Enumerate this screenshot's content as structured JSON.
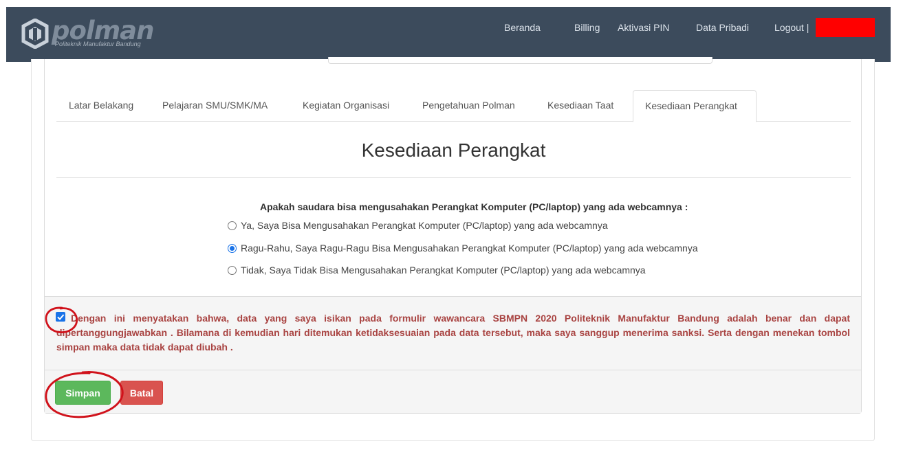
{
  "header": {
    "logo_text": "polman",
    "logo_subtitle": "Politeknik Manufaktur Bandung",
    "nav": {
      "beranda": "Beranda",
      "billing": "Billing",
      "aktivasi_pin": "Aktivasi PIN",
      "data_pribadi": "Data Pribadi",
      "logout": "Logout |"
    }
  },
  "tabs": {
    "latar_belakang": "Latar Belakang",
    "pelajaran": "Pelajaran SMU/SMK/MA",
    "kegiatan": "Kegiatan Organisasi",
    "pengetahuan": "Pengetahuan Polman",
    "kesediaan_taat": "Kesediaan Taat",
    "kesediaan_perangkat": "Kesediaan Perangkat",
    "active": "Kesediaan Perangkat"
  },
  "section": {
    "title": "Kesediaan Perangkat",
    "question": "Apakah saudara bisa mengusahakan Perangkat Komputer (PC/laptop) yang ada webcamnya :",
    "options": [
      {
        "label": "Ya, Saya Bisa Mengusahakan Perangkat Komputer (PC/laptop) yang ada webcamnya",
        "selected": false
      },
      {
        "label": "Ragu-Rahu, Saya Ragu-Ragu Bisa Mengusahakan Perangkat Komputer (PC/laptop) yang ada webcamnya",
        "selected": true
      },
      {
        "label": "Tidak, Saya Tidak Bisa Mengusahakan Perangkat Komputer (PC/laptop) yang ada webcamnya",
        "selected": false
      }
    ]
  },
  "agreement": {
    "checked": true,
    "text": "Dengan ini menyatakan bahwa, data yang saya isikan pada formulir wawancara SBMPN 2020 Politeknik Manufaktur Bandung adalah benar dan dapat dipertanggungjawabkan . Bilamana di kemudian hari ditemukan ketidaksesuaian pada data tersebut, maka saya sanggup menerima sanksi. Serta dengan menekan tombol simpan maka data tidak dapat diubah ."
  },
  "buttons": {
    "save": "Simpan",
    "cancel": "Batal"
  },
  "colors": {
    "navbar": "#3c4b5c",
    "save_button": "#5cb85c",
    "cancel_button": "#d9534f",
    "agreement_text": "#a94442",
    "annotation_circle": "#d0121b",
    "redaction": "#ff0000"
  }
}
